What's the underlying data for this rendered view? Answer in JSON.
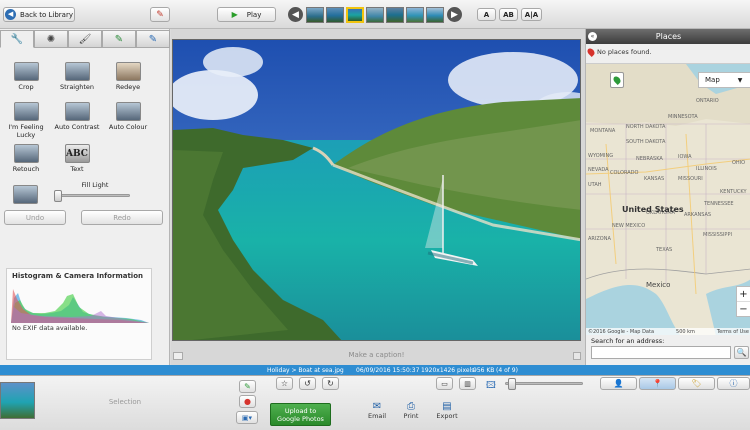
{
  "toolbar": {
    "back_label": "Back to Library",
    "play_label": "Play",
    "view_modes": [
      "A",
      "AB",
      "A|A"
    ]
  },
  "left_panel": {
    "tabs": [
      "wrench-icon",
      "sun-icon",
      "brush-icon",
      "pen-icon",
      "pen-blue-icon"
    ],
    "tools": [
      "Crop",
      "Straighten",
      "Redeye",
      "I'm Feeling Lucky",
      "Auto Contrast",
      "Auto Colour",
      "Retouch",
      "Text"
    ],
    "fill_light_label": "Fill Light",
    "fill_light_value": 0,
    "undo_label": "Undo",
    "redo_label": "Redo",
    "histogram_title": "Histogram & Camera Information",
    "exif_text": "No EXIF data available."
  },
  "canvas": {
    "caption_placeholder": "Make a caption!"
  },
  "places": {
    "title": "Places",
    "no_places": "No places found.",
    "map_type": "Map",
    "labels": {
      "usa": "United States",
      "mexico": "Mexico",
      "states": [
        "ONTARIO",
        "NORTH DAKOTA",
        "MONTANA",
        "SOUTH DAKOTA",
        "WYOMING",
        "NEBRASKA",
        "IOWA",
        "MINNESOTA",
        "ILLINOIS",
        "OHIO",
        "KANSAS",
        "MISSOURI",
        "COLORADO",
        "UTAH",
        "NEVADA",
        "OKLAHOMA",
        "ARKANSAS",
        "NEW MEXICO",
        "ARIZONA",
        "TEXAS",
        "MISSISSIPPI",
        "TENNESSEE",
        "KENTUCKY"
      ]
    },
    "copyright": "©2016 Google - Map Data",
    "scale": "500 km",
    "terms": "Terms of Use",
    "search_label": "Search for an address:",
    "zoom_in": "+",
    "zoom_out": "−"
  },
  "status": {
    "path": "Holiday > Boat at sea.jpg",
    "datetime": "06/09/2016 15:50:37",
    "dimensions": "1920x1426 pixels",
    "size": "956 KB",
    "index": "(4 of 9)"
  },
  "bottom": {
    "selection_label": "Selection",
    "upload_label": "Upload to Google Photos",
    "actions": [
      "Email",
      "Print",
      "Export"
    ]
  }
}
